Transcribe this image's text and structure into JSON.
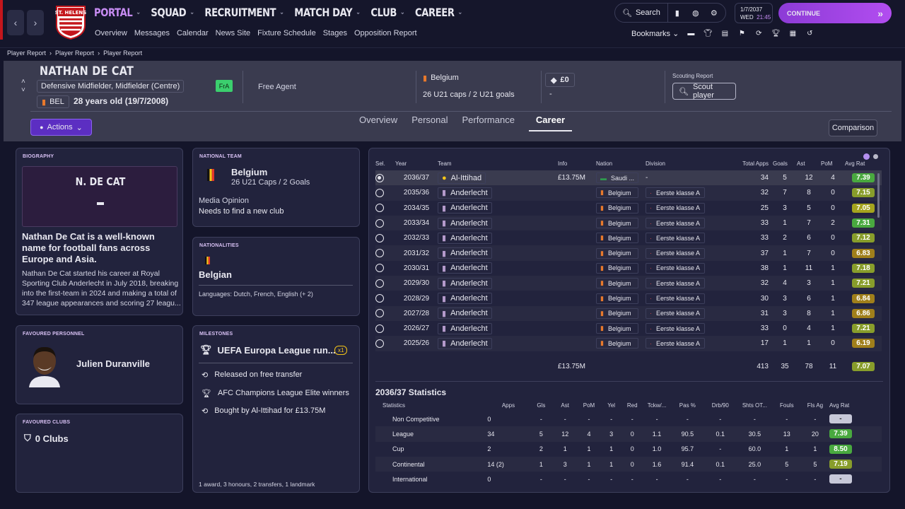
{
  "nav": {
    "main": [
      {
        "label": "PORTAL"
      },
      {
        "label": "SQUAD"
      },
      {
        "label": "RECRUITMENT"
      },
      {
        "label": "MATCH DAY"
      },
      {
        "label": "CLUB"
      },
      {
        "label": "CAREER"
      }
    ],
    "sub": [
      "Overview",
      "Messages",
      "Calendar",
      "News Site",
      "Fixture Schedule",
      "Stages",
      "Opposition Report"
    ],
    "search": "Search",
    "date": "1/7/2037",
    "day": "WED",
    "time": "21:45",
    "continue": "CONTINUE",
    "bookmarks": "Bookmarks",
    "crest_text": "ST. HELENS"
  },
  "breadcrumb": [
    "Player Report",
    "Player Report",
    "Player Report"
  ],
  "player": {
    "name": "NATHAN DE CAT",
    "position": "Defensive Midfielder, Midfielder (Centre)",
    "nationality": "BEL",
    "age": "28 years old (19/7/2008)",
    "fra": "FrA",
    "status": "Free Agent",
    "nation": "Belgium",
    "caps": "26 U21 caps / 2 U21 goals",
    "value": "£0",
    "value_sub": "-",
    "scout_label": "Scouting Report",
    "scout_btn": "Scout player"
  },
  "actions": "Actions",
  "tabs": [
    "Overview",
    "Personal",
    "Performance",
    "Career"
  ],
  "comparison": "Comparison",
  "bio": {
    "title": "BIOGRAPHY",
    "head": "N. DE CAT",
    "headline": "Nathan De Cat is a well-known name for football fans across Europe and Asia.",
    "text": "Nathan De Cat started his career at Royal Sporting Club Anderlecht in July 2018, breaking into the first-team in 2024 and making a total of 347 league appearances and scoring 27 leagu..."
  },
  "personnel": {
    "title": "FAVOURED PERSONNEL",
    "name": "Julien Duranville"
  },
  "clubs": {
    "title": "FAVOURED CLUBS",
    "value": "0 Clubs"
  },
  "national": {
    "title": "NATIONAL TEAM",
    "country": "Belgium",
    "caps": "26 U21 Caps / 2 Goals",
    "media_label": "Media Opinion",
    "media": "Needs to find a new club"
  },
  "nationalities": {
    "title": "NATIONALITIES",
    "value": "Belgian",
    "languages": "Languages: Dutch, French, English (+ 2)"
  },
  "milestones": {
    "title": "MILESTONES",
    "headline": "UEFA Europa League run...",
    "count": "x1",
    "items": [
      "Released on free transfer",
      "AFC Champions League Elite winners",
      "Bought by Al-Ittihad for £13.75M"
    ],
    "footer": "1 award, 3 honours, 2 transfers, 1 landmark"
  },
  "history": {
    "columns": [
      "Sel.",
      "Year",
      "Team",
      "Info",
      "Nation",
      "Division",
      "Total Apps",
      "Goals",
      "Ast",
      "PoM",
      "Avg Rat"
    ],
    "rows": [
      {
        "year": "2036/37",
        "team": "Al-Ittihad",
        "info": "£13.75M",
        "nation": "Saudi ...",
        "division": "-",
        "apps": "34",
        "goals": "5",
        "ast": "12",
        "pom": "4",
        "rat": "7.39"
      },
      {
        "year": "2035/36",
        "team": "Anderlecht",
        "info": "",
        "nation": "Belgium",
        "division": "Eerste klasse A",
        "apps": "32",
        "goals": "7",
        "ast": "8",
        "pom": "0",
        "rat": "7.15"
      },
      {
        "year": "2034/35",
        "team": "Anderlecht",
        "info": "",
        "nation": "Belgium",
        "division": "Eerste klasse A",
        "apps": "25",
        "goals": "3",
        "ast": "5",
        "pom": "0",
        "rat": "7.05"
      },
      {
        "year": "2033/34",
        "team": "Anderlecht",
        "info": "",
        "nation": "Belgium",
        "division": "Eerste klasse A",
        "apps": "33",
        "goals": "1",
        "ast": "7",
        "pom": "2",
        "rat": "7.31"
      },
      {
        "year": "2032/33",
        "team": "Anderlecht",
        "info": "",
        "nation": "Belgium",
        "division": "Eerste klasse A",
        "apps": "33",
        "goals": "2",
        "ast": "6",
        "pom": "0",
        "rat": "7.12"
      },
      {
        "year": "2031/32",
        "team": "Anderlecht",
        "info": "",
        "nation": "Belgium",
        "division": "Eerste klasse A",
        "apps": "37",
        "goals": "1",
        "ast": "7",
        "pom": "0",
        "rat": "6.83"
      },
      {
        "year": "2030/31",
        "team": "Anderlecht",
        "info": "",
        "nation": "Belgium",
        "division": "Eerste klasse A",
        "apps": "38",
        "goals": "1",
        "ast": "11",
        "pom": "1",
        "rat": "7.18"
      },
      {
        "year": "2029/30",
        "team": "Anderlecht",
        "info": "",
        "nation": "Belgium",
        "division": "Eerste klasse A",
        "apps": "32",
        "goals": "4",
        "ast": "3",
        "pom": "1",
        "rat": "7.21"
      },
      {
        "year": "2028/29",
        "team": "Anderlecht",
        "info": "",
        "nation": "Belgium",
        "division": "Eerste klasse A",
        "apps": "30",
        "goals": "3",
        "ast": "6",
        "pom": "1",
        "rat": "6.84"
      },
      {
        "year": "2027/28",
        "team": "Anderlecht",
        "info": "",
        "nation": "Belgium",
        "division": "Eerste klasse A",
        "apps": "31",
        "goals": "3",
        "ast": "8",
        "pom": "1",
        "rat": "6.86"
      },
      {
        "year": "2026/27",
        "team": "Anderlecht",
        "info": "",
        "nation": "Belgium",
        "division": "Eerste klasse A",
        "apps": "33",
        "goals": "0",
        "ast": "4",
        "pom": "1",
        "rat": "7.21"
      },
      {
        "year": "2025/26",
        "team": "Anderlecht",
        "info": "",
        "nation": "Belgium",
        "division": "Eerste klasse A",
        "apps": "17",
        "goals": "1",
        "ast": "1",
        "pom": "0",
        "rat": "6.19"
      }
    ],
    "totals": {
      "info": "£13.75M",
      "apps": "413",
      "goals": "35",
      "ast": "78",
      "pom": "11",
      "rat": "7.07"
    }
  },
  "stats": {
    "title": "2036/37 Statistics",
    "columns": [
      "Statistics",
      "Apps",
      "Gls",
      "Ast",
      "PoM",
      "Yel",
      "Red",
      "Tckw/...",
      "Pas %",
      "Drb/90",
      "Shts OT...",
      "Fouls",
      "Fls Ag",
      "Avg Rat"
    ],
    "rows": [
      [
        "Non Competitive",
        "0",
        "-",
        "-",
        "-",
        "-",
        "-",
        "-",
        "-",
        "-",
        "-",
        "-",
        "-",
        "-"
      ],
      [
        "League",
        "34",
        "5",
        "12",
        "4",
        "3",
        "0",
        "1.1",
        "90.5",
        "0.1",
        "30.5",
        "13",
        "20",
        "7.39"
      ],
      [
        "Cup",
        "2",
        "2",
        "1",
        "1",
        "1",
        "0",
        "1.0",
        "95.7",
        "-",
        "60.0",
        "1",
        "1",
        "8.50"
      ],
      [
        "Continental",
        "14 (2)",
        "1",
        "3",
        "1",
        "1",
        "0",
        "1.6",
        "91.4",
        "0.1",
        "25.0",
        "5",
        "5",
        "7.19"
      ],
      [
        "International",
        "0",
        "-",
        "-",
        "-",
        "-",
        "-",
        "-",
        "-",
        "-",
        "-",
        "-",
        "-",
        "-"
      ]
    ]
  }
}
